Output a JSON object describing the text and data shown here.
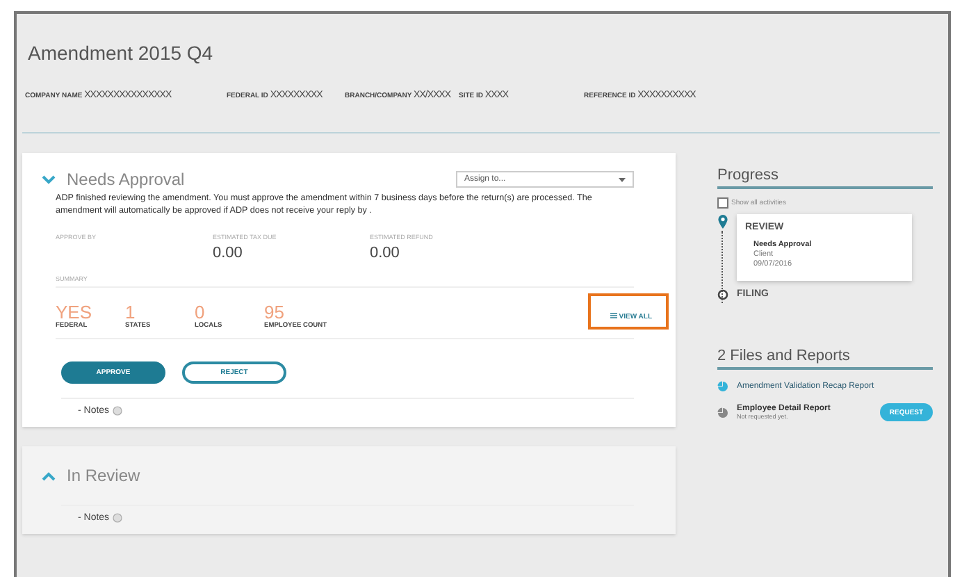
{
  "title": "Amendment 2015 Q4",
  "header_fields": [
    {
      "label": "COMPANY NAME",
      "value": "XXXXXXXXXXXXXXX"
    },
    {
      "label": "FEDERAL ID",
      "value": "XXXXXXXXX"
    },
    {
      "label": "BRANCH/COMPANY",
      "value": "XX/XXXX"
    },
    {
      "label": "SITE ID",
      "value": "XXXX"
    },
    {
      "label": "REFERENCE ID",
      "value": "XXXXXXXXXX"
    }
  ],
  "sections": [
    {
      "title": "Needs Approval",
      "expanded": true,
      "assign": {
        "placeholder": "Assign to..."
      },
      "message": "ADP finished reviewing the amendment. You must approve the amendment within 7 business days before the return(s) are processed. The amendment will automatically be approved if ADP does not receive your reply by .",
      "figures": [
        {
          "label": "APPROVE BY"
        },
        {
          "label": "ESTIMATED TAX DUE",
          "value": "0.00"
        },
        {
          "label": "ESTIMATED REFUND",
          "value": "0.00"
        }
      ],
      "summary_label": "SUMMARY",
      "summary": [
        {
          "value": "YES",
          "label": "FEDERAL"
        },
        {
          "value": "1",
          "label": "STATES"
        },
        {
          "value": "0",
          "label": "LOCALS"
        },
        {
          "value": "95",
          "label": "EMPLOYEE COUNT"
        }
      ],
      "view_all": {
        "label": "VIEW ALL",
        "highlighted": true
      },
      "buttons": [
        {
          "label": "APPROVE",
          "kind": "primary"
        },
        {
          "label": "REJECT",
          "kind": "secondary"
        }
      ],
      "notes": "- Notes"
    },
    {
      "title": "In Review",
      "expanded": false,
      "notes": "- Notes"
    }
  ],
  "progress": {
    "title": "Progress",
    "show_all": {
      "label": "Show all activities",
      "checked": false
    },
    "steps": [
      {
        "label": "REVIEW",
        "selected": true,
        "detail": [
          "Needs Approval",
          "Client",
          "09/07/2016"
        ]
      },
      {
        "label": "FILING",
        "selected": false
      }
    ]
  },
  "files": {
    "title": "2 Files and Reports",
    "items": [
      {
        "name": "Amendment Validation Recap Report",
        "available": true
      },
      {
        "name": "Employee Detail Report",
        "available": false,
        "status": "Not requested yet.",
        "action": "REQUEST"
      }
    ]
  }
}
